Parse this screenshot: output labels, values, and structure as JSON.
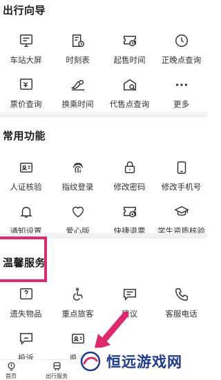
{
  "sections": {
    "travel": {
      "title": "出行向导",
      "items": [
        {
          "label": "车站大屏",
          "icon": "station-screen-icon"
        },
        {
          "label": "时刻表",
          "icon": "timetable-icon"
        },
        {
          "label": "起售时间",
          "icon": "sale-time-icon"
        },
        {
          "label": "正晚点查询",
          "icon": "clock-icon"
        },
        {
          "label": "票价查询",
          "icon": "ticket-price-icon"
        },
        {
          "label": "换乘时间",
          "icon": "transfer-time-icon"
        },
        {
          "label": "代售点查询",
          "icon": "agency-icon"
        },
        {
          "label": "更多",
          "icon": "more-icon"
        }
      ]
    },
    "common": {
      "title": "常用功能",
      "items": [
        {
          "label": "人证核验",
          "icon": "id-verify-icon"
        },
        {
          "label": "指纹登录",
          "icon": "fingerprint-icon"
        },
        {
          "label": "修改密码",
          "icon": "lock-icon"
        },
        {
          "label": "修改手机号",
          "icon": "phone-icon"
        },
        {
          "label": "通知设置",
          "icon": "bell-icon"
        },
        {
          "label": "爱心版",
          "icon": "heart-icon"
        },
        {
          "label": "快捷退票",
          "icon": "refund-icon"
        },
        {
          "label": "学生资质核验",
          "icon": "graduation-cap-icon"
        }
      ]
    },
    "service": {
      "title": "温馨服务",
      "items": [
        {
          "label": "遗失物品",
          "icon": "lost-items-icon"
        },
        {
          "label": "重点旅客",
          "icon": "wheelchair-icon"
        },
        {
          "label": "建议",
          "icon": "suggestion-icon"
        },
        {
          "label": "客服电话",
          "icon": "phone-call-icon"
        },
        {
          "label": "投诉",
          "icon": "complaint-icon"
        },
        {
          "label": "临时",
          "icon": "temp-id-icon"
        }
      ]
    }
  },
  "bottom_nav": [
    {
      "label": "首页",
      "icon": "home-icon"
    },
    {
      "label": "出行服务",
      "icon": "train-icon"
    }
  ],
  "watermark": {
    "text": "恒远游戏网"
  },
  "colors": {
    "highlight": "#e0286f",
    "watermark_text": "#1d3a8c",
    "arrow": "#e0286f"
  }
}
